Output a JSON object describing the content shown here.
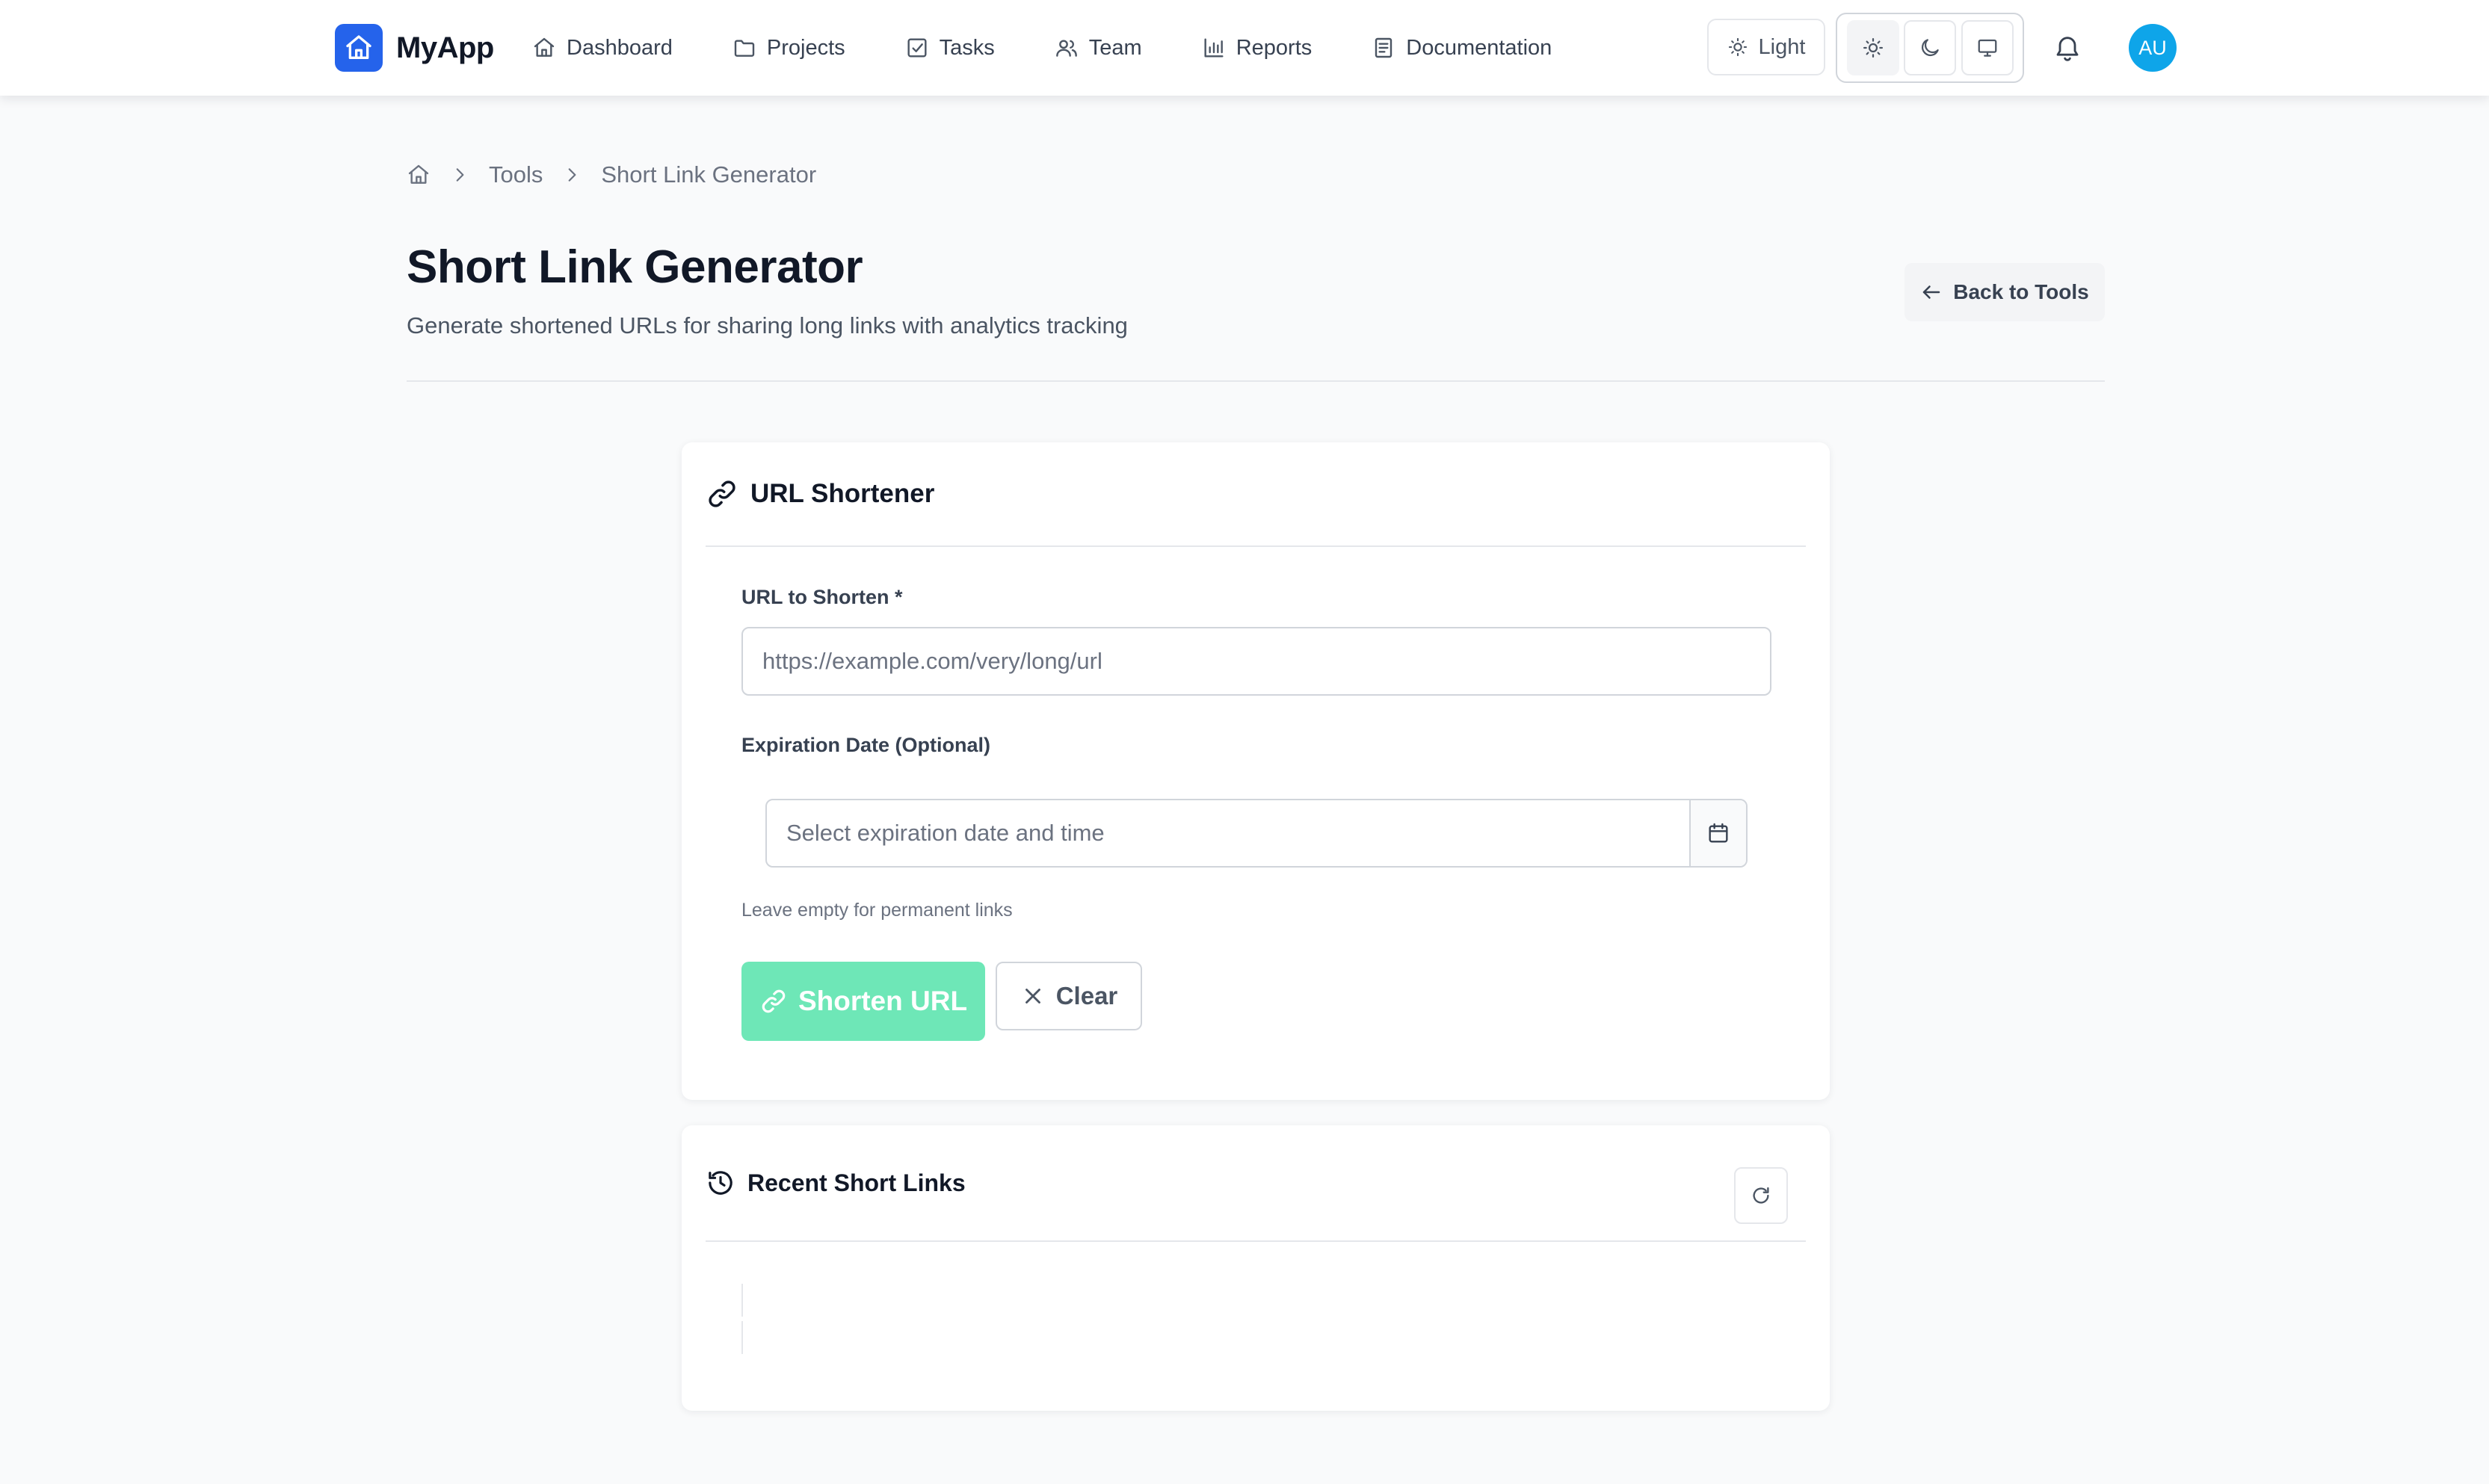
{
  "app": {
    "name": "MyApp",
    "accent": "#2563eb"
  },
  "nav": {
    "items": [
      {
        "label": "Dashboard",
        "icon": "home-icon"
      },
      {
        "label": "Projects",
        "icon": "folder-icon"
      },
      {
        "label": "Tasks",
        "icon": "checkbox-icon"
      },
      {
        "label": "Team",
        "icon": "users-icon"
      },
      {
        "label": "Reports",
        "icon": "bar-chart-icon"
      },
      {
        "label": "Documentation",
        "icon": "document-icon"
      }
    ],
    "theme_label": "Light",
    "theme_options": [
      "sun-icon",
      "moon-icon",
      "monitor-icon"
    ],
    "theme_selected": "sun-icon",
    "avatar_initials": "AU",
    "avatar_color": "#0ea5e9"
  },
  "breadcrumb": {
    "items": [
      "Tools",
      "Short Link Generator"
    ]
  },
  "page": {
    "title": "Short Link Generator",
    "subtitle": "Generate shortened URLs for sharing long links with analytics tracking",
    "back_label": "Back to Tools"
  },
  "shortener": {
    "title": "URL Shortener",
    "url_label": "URL to Shorten *",
    "url_placeholder": "https://example.com/very/long/url",
    "url_value": "",
    "expiry_label": "Expiration Date (Optional)",
    "expiry_placeholder": "Select expiration date and time",
    "expiry_value": "",
    "hint": "Leave empty for permanent links",
    "submit_label": "Shorten URL",
    "submit_color": "#6ee7b7",
    "clear_label": "Clear"
  },
  "recent": {
    "title": "Recent Short Links",
    "items": []
  }
}
